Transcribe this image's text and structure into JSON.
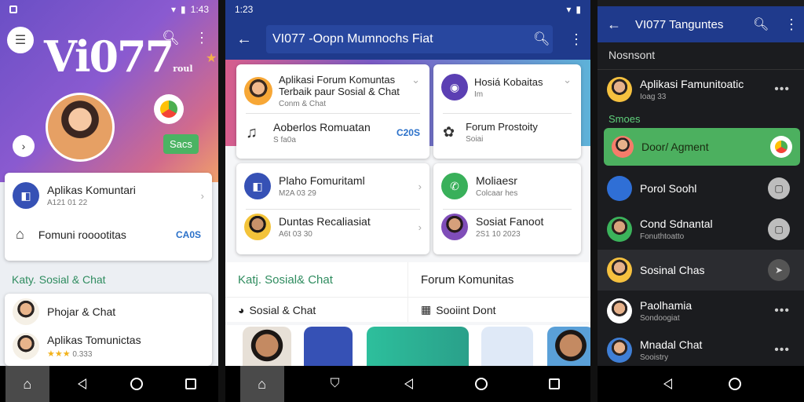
{
  "phone1": {
    "status": {
      "time": "1:43"
    },
    "logo_text": "Vi077",
    "logo_small": "roul",
    "save_label": "Sacs",
    "card1": {
      "title": "Aplikas Komuntari",
      "subtitle": "A121 01 22",
      "item2_title": "Fomuni rooootitas",
      "item2_badge": "CA0S"
    },
    "section_title": "Katy. Sosial & Chat",
    "list": [
      {
        "title": "Phojar & Chat"
      },
      {
        "title": "Aplikas Tomunictas",
        "rating": "0.333"
      }
    ]
  },
  "phone2": {
    "status": {
      "time": "1:23"
    },
    "search_text": "VI077 -Oopn Mumnochs Fiat",
    "cards": [
      {
        "title": "Aplikasi Forum Komuntas",
        "title2": "Terbaik paur Sosial & Chat",
        "sub": "Conm & Chat",
        "item_title": "Aoberlos Romuatan",
        "item_sub": "S fa0a",
        "badge": "C20S"
      },
      {
        "title": "Hosiá Kobaitas",
        "sub": "Im",
        "item_title": "Forum Prostoity",
        "item_sub": "Soiai"
      },
      {
        "title": "Plaho Fomuritaml",
        "sub": "M2A 03 29",
        "item_title": "Duntas Recaliasiat",
        "item_sub": "A6t 03 30"
      },
      {
        "title": "Moliaesr",
        "sub": "Colcaar hes",
        "item_title": "Sosiat Fanoot",
        "item_sub": "2S1 10 2023"
      }
    ],
    "tabs": [
      "Katj. Sosial& Chat",
      "Forum Komunitas"
    ],
    "subtabs": [
      "Sosial & Chat",
      "Sooiint Dont"
    ]
  },
  "phone3": {
    "status": {
      "time": ""
    },
    "title": "VI077 Tanguntes",
    "header": "Nosnsont",
    "first": {
      "name": "Aplikasi Famunitoatic",
      "sub": "Ioag 33"
    },
    "section": "Smoes",
    "highlight": "Door/ Agment",
    "items": [
      {
        "name": "Porol Soohl",
        "sub": ""
      },
      {
        "name": "Cond Sdnantal",
        "sub": "Fonuthtoatto"
      },
      {
        "name": "Sosinal Chas",
        "sub": ""
      },
      {
        "name": "Paolhamia",
        "sub": "Sondoogiat"
      },
      {
        "name": "Mnadal Chat",
        "sub": "Sooistry"
      }
    ]
  },
  "colors": {
    "appbar": "#1f3a8c",
    "accent_green": "#4cb05f",
    "accent_blue": "#2a70c9"
  }
}
